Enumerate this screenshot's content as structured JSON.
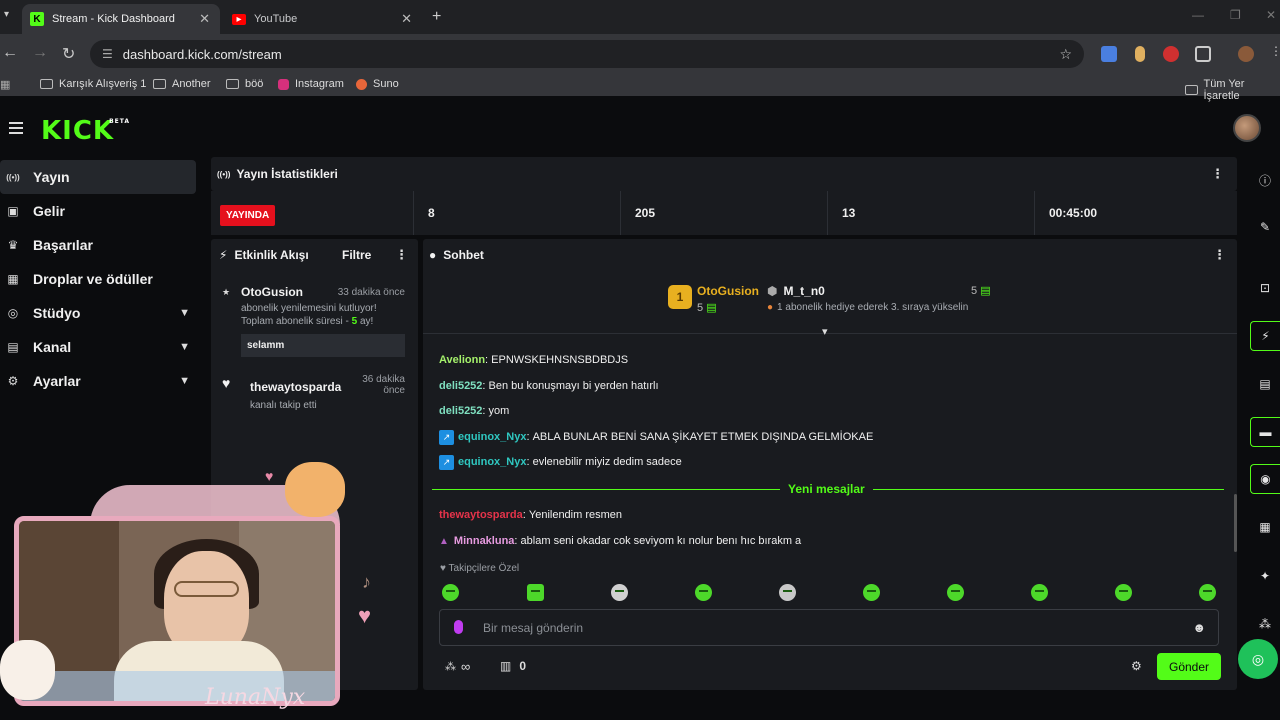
{
  "browser": {
    "tabs": [
      {
        "title": "Stream - Kick Dashboard",
        "active": true
      },
      {
        "title": "YouTube",
        "active": false
      }
    ],
    "url": "dashboard.kick.com/stream",
    "bookmarks": [
      "Karışık Alışveriş 1",
      "Another",
      "böö",
      "Instagram",
      "Suno"
    ],
    "bookmarks_right": "Tüm Yer İşaretle"
  },
  "app": {
    "logo": "KICK",
    "logo_sup": "BETA"
  },
  "sidebar": {
    "items": [
      {
        "label": "Yayın",
        "icon": "broadcast-icon",
        "glyph": "((•))",
        "active": true,
        "expandable": false
      },
      {
        "label": "Gelir",
        "icon": "revenue-icon",
        "glyph": "▣",
        "active": false,
        "expandable": false
      },
      {
        "label": "Başarılar",
        "icon": "trophy-icon",
        "glyph": "♛",
        "active": false,
        "expandable": false
      },
      {
        "label": "Droplar ve ödüller",
        "icon": "gift-icon",
        "glyph": "▦",
        "active": false,
        "expandable": false
      },
      {
        "label": "Stüdyo",
        "icon": "studio-icon",
        "glyph": "◎",
        "active": false,
        "expandable": true
      },
      {
        "label": "Kanal",
        "icon": "channel-icon",
        "glyph": "▤",
        "active": false,
        "expandable": true
      },
      {
        "label": "Ayarlar",
        "icon": "gear-icon",
        "glyph": "⚙",
        "active": false,
        "expandable": true
      }
    ]
  },
  "stats": {
    "title": "Yayın İstatistikleri",
    "live_label": "YAYINDA",
    "values": [
      "8",
      "205",
      "13",
      "00:45:00"
    ]
  },
  "activity": {
    "title": "Etkinlik Akışı",
    "filter_label": "Filtre",
    "events": [
      {
        "user": "OtoGusion",
        "time": "33 dakika önce",
        "line1": "abonelik yenilemesini kutluyor!",
        "line2_prefix": "Toplam abonelik süresi - ",
        "line2_value": "5",
        "line2_suffix": " ay!",
        "message": "selamm"
      },
      {
        "user": "thewaytosparda",
        "time_line1": "36 dakika",
        "time_line2": "önce",
        "line1": "kanalı takip etti"
      }
    ]
  },
  "chat": {
    "title": "Sohbet",
    "leaderboard": {
      "first_user": "OtoGusion",
      "first_rank": "1",
      "first_count": "5",
      "gifter_user": "M_t_n0",
      "gifter_count": "5",
      "gifter_note": "1 abonelik hediye ederek 3. sıraya yükselin"
    },
    "messages": [
      {
        "user": "Avelionn",
        "color": "#a4f06b",
        "text": "EPNWSKEHNSNSBDBDJS",
        "badge": false
      },
      {
        "user": "deli5252",
        "color": "#7fe0c0",
        "text": "Ben bu konuşmayı bi yerden hatırlı",
        "badge": false
      },
      {
        "user": "deli5252",
        "color": "#7fe0c0",
        "text": "yom",
        "badge": false
      },
      {
        "user": "equinox_Nyx",
        "color": "#2fc7c0",
        "text": "ABLA BUNLAR BENİ SANA ŞİKAYET ETMEK DIŞINDA GELMİOKAE",
        "badge": true
      },
      {
        "user": "equinox_Nyx",
        "color": "#2fc7c0",
        "text": "evlenebilir miyiz dedim sadece",
        "badge": true
      }
    ],
    "new_messages_label": "Yeni mesajlar",
    "new_messages": [
      {
        "user": "thewaytosparda",
        "color": "#e5334a",
        "text": "Yenilendim resmen"
      },
      {
        "user": "Minnakluna",
        "color": "#e79be0",
        "text": "ablam seni okadar cok seviyom kı nolur benı hıc bırakm a"
      }
    ],
    "emote_section": "Takipçilere Özel",
    "input_placeholder": "Bir mesaj gönderin",
    "points": "∞",
    "store_count": "0",
    "send_label": "Gönder"
  },
  "overlay": {
    "name": "LunaNyx"
  },
  "colors": {
    "accent": "#53fc18",
    "live": "#e5101d",
    "panel": "#191b1f",
    "bg": "#0b0c0e"
  }
}
